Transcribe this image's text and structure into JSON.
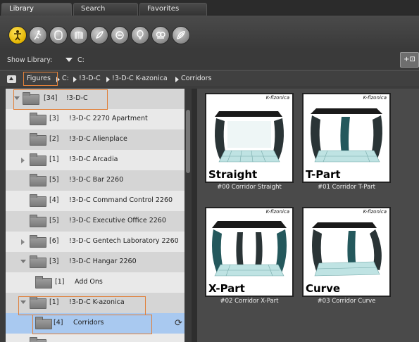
{
  "tabs": [
    {
      "label": "Library"
    },
    {
      "label": "Search"
    },
    {
      "label": "Favorites"
    }
  ],
  "category_icons": [
    {
      "name": "figures-icon",
      "active": true
    },
    {
      "name": "poses-icon",
      "active": false
    },
    {
      "name": "expressions-icon",
      "active": false
    },
    {
      "name": "hair-icon",
      "active": false
    },
    {
      "name": "hands-icon",
      "active": false
    },
    {
      "name": "props-icon",
      "active": false
    },
    {
      "name": "lights-icon",
      "active": false
    },
    {
      "name": "cameras-icon",
      "active": false
    },
    {
      "name": "materials-icon",
      "active": false
    }
  ],
  "show_library": {
    "label": "Show Library:",
    "value": "C:"
  },
  "breadcrumb": {
    "root": "Figures",
    "items": [
      "C:",
      "!3-D-C",
      "!3-D-C K-azonica",
      "Corridors"
    ]
  },
  "tree": [
    {
      "count": "[34]",
      "name": "!3-D-C",
      "expander": "down",
      "level": 0
    },
    {
      "count": "[3]",
      "name": "!3-D-C 2270 Apartment",
      "expander": "none",
      "level": 1
    },
    {
      "count": "[2]",
      "name": "!3-D-C Alienplace",
      "expander": "none",
      "level": 1
    },
    {
      "count": "[1]",
      "name": "!3-D-C Arcadia",
      "expander": "right",
      "level": 1
    },
    {
      "count": "[5]",
      "name": "!3-D-C Bar 2260",
      "expander": "none",
      "level": 1
    },
    {
      "count": "[4]",
      "name": "!3-D-C Command Control 2260",
      "expander": "none",
      "level": 1
    },
    {
      "count": "[5]",
      "name": "!3-D-C Executive Office 2260",
      "expander": "none",
      "level": 1
    },
    {
      "count": "[6]",
      "name": "!3-D-C Gentech Laboratory 2260",
      "expander": "right",
      "level": 1
    },
    {
      "count": "[3]",
      "name": "!3-D-C Hangar 2260",
      "expander": "down",
      "level": 1
    },
    {
      "count": "[1]",
      "name": "Add Ons",
      "expander": "none",
      "level": 2
    },
    {
      "count": "[1]",
      "name": "!3-D-C K-azonica",
      "expander": "down",
      "level": 1
    },
    {
      "count": "[4]",
      "name": "Corridors",
      "expander": "none",
      "level": 2,
      "selected": true
    }
  ],
  "items": [
    {
      "brand": "K-flzonica",
      "label": "Straight",
      "caption": "#00 Corridor Straight"
    },
    {
      "brand": "K-flzonica",
      "label": "T-Part",
      "caption": "#01 Corridor T-Part"
    },
    {
      "brand": "K-flzonica",
      "label": "X-Part",
      "caption": "#02 Corridor X-Part"
    },
    {
      "brand": "K-flzonica",
      "label": "Curve",
      "caption": "#03 Corridor Curve"
    }
  ],
  "colors": {
    "highlight": "#e0803a",
    "selected_row": "#a9c9f0",
    "active_icon": "#e3b400"
  }
}
